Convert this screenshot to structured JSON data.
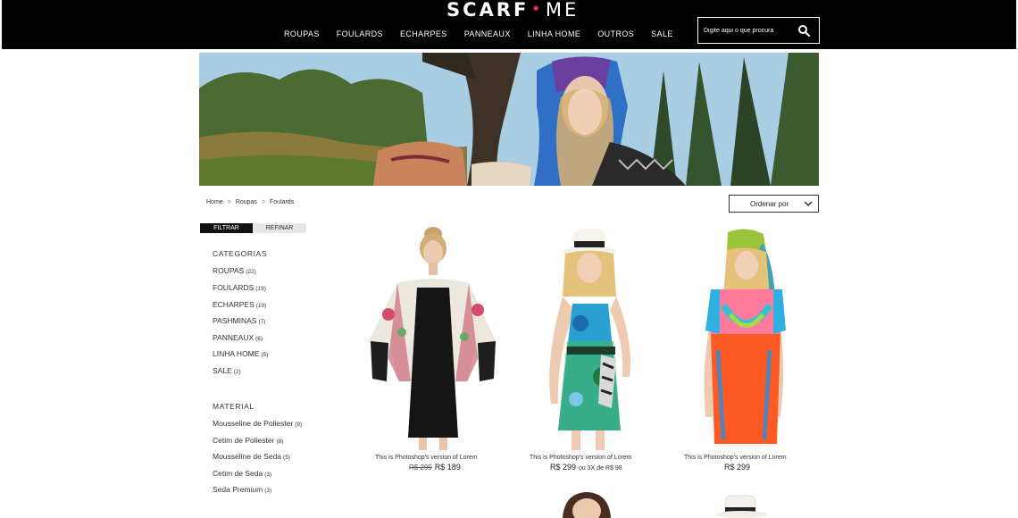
{
  "header": {
    "logo_left": "SCARF",
    "logo_dot": "•",
    "logo_right": "ME",
    "nav": [
      "ROUPAS",
      "FOULARDS",
      "ECHARPES",
      "PANNEAUX",
      "LINHA HOME",
      "OUTROS",
      "SALE"
    ],
    "search_placeholder": "Digite aqui o que procura",
    "search_icon": "search-icon"
  },
  "breadcrumb": [
    "Home",
    "Roupas",
    "Foulards"
  ],
  "breadcrumb_sep": ">",
  "sort": {
    "label": "Ordenar por",
    "icon": "chevron-down-icon"
  },
  "filter_tabs": {
    "filtrar": "FILTRAR",
    "refinar": "REFINAR"
  },
  "sidebar": {
    "categories_heading": "CATEGORIAS",
    "categories": [
      {
        "label": "ROUPAS",
        "count": "(22)"
      },
      {
        "label": "FOULARDS",
        "count": "(19)"
      },
      {
        "label": "ECHARPES",
        "count": "(10)"
      },
      {
        "label": "PASHMINAS",
        "count": "(7)"
      },
      {
        "label": "PANNEAUX",
        "count": "(6)"
      },
      {
        "label": "LINHA HOME",
        "count": "(5)"
      },
      {
        "label": "SALE",
        "count": "(2)"
      }
    ],
    "material_heading": "MATERIAL",
    "materials": [
      {
        "label": "Mousseline de Poliester",
        "count": "(9)"
      },
      {
        "label": "Cetim de Poliester",
        "count": "(8)"
      },
      {
        "label": "Mousseline de Seda",
        "count": "(5)"
      },
      {
        "label": "Cetim de Seda",
        "count": "(3)"
      },
      {
        "label": "Seda Premium",
        "count": "(3)"
      }
    ]
  },
  "products": [
    {
      "title": "This is Photoshop's version  of Lorem",
      "old_price": "R$ 299",
      "price": "R$ 189",
      "installments": ""
    },
    {
      "title": "This is Photoshop's version  of Lorem",
      "old_price": "",
      "price": "R$ 299",
      "installments": "ou 3X de R$ 98"
    },
    {
      "title": "This is Photoshop's version  of Lorem",
      "old_price": "",
      "price": "R$ 299",
      "installments": ""
    }
  ],
  "colors": {
    "header_bg": "#000000",
    "logo_dot": "#e2334a",
    "accent_tab": "#111111"
  }
}
